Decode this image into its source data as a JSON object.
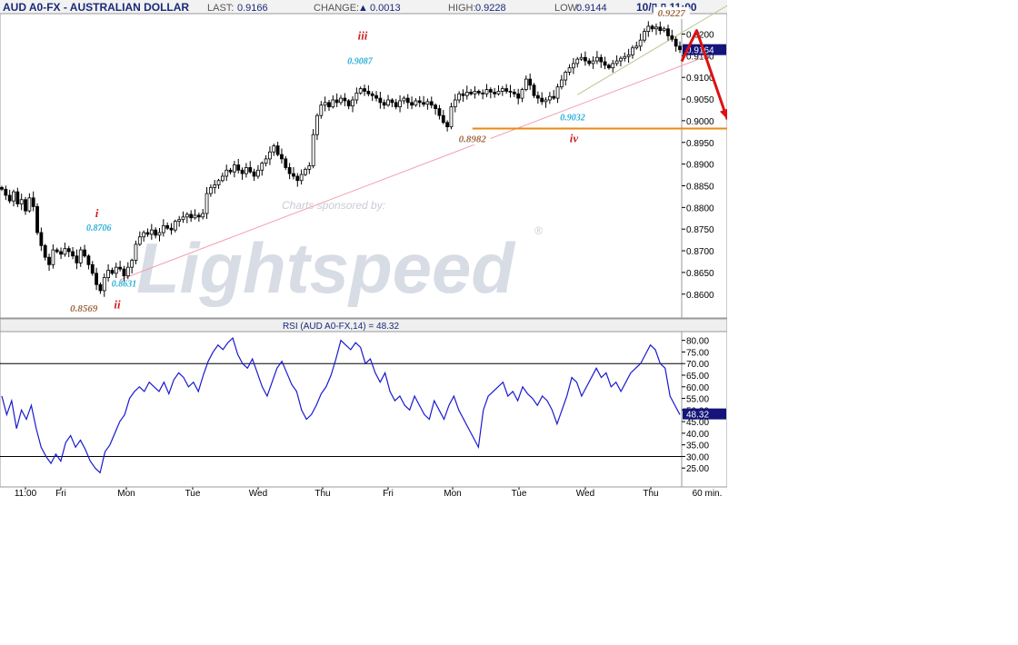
{
  "header": {
    "symbol": "AUD A0-FX - AUSTRALIAN DOLLAR",
    "last_label": "LAST:",
    "last_value": "0.9166",
    "change_label": "CHANGE:",
    "change_arrow": "▲",
    "change_value": "0.0013",
    "high_label": "HIGH:",
    "high_value": "0.9228",
    "low_label": "LOW:",
    "low_value": "0.9144",
    "datetime": "10/▯ ▯ 11:00"
  },
  "colors": {
    "candle": "#000000",
    "rsi_line": "#1a1ad0",
    "trendline_pink": "#f0a0b0",
    "trendline_green": "#b8c890",
    "support_line": "#e88a10",
    "arrow": "#dd1111",
    "wave_label": "#cc2222",
    "value_cyan": "#2ab0d8",
    "value_brown": "#a06a48",
    "last_box": "#14147a"
  },
  "watermark": {
    "sponsor_text": "Charts sponsored by:",
    "logo_text": "Lightspeed",
    "registered": "®"
  },
  "chart_data": [
    {
      "type": "candlestick",
      "title": "AUD A0-FX - AUSTRALIAN DOLLAR",
      "interval": "60 min.",
      "ylim": [
        0.8545,
        0.9245
      ],
      "yticks": [
        "0.9200",
        "0.9150",
        "0.9100",
        "0.9050",
        "0.9000",
        "0.8950",
        "0.8900",
        "0.8850",
        "0.8800",
        "0.8750",
        "0.8700",
        "0.8650",
        "0.8600"
      ],
      "x_labels": [
        "11:00",
        "Fri",
        "Mon",
        "Tue",
        "Wed",
        "Thu",
        "Fri",
        "Mon",
        "Tue",
        "Wed",
        "Thu"
      ],
      "last_price": "0.9164",
      "close_path": [
        0.8842,
        0.8828,
        0.8815,
        0.8836,
        0.8808,
        0.8818,
        0.8792,
        0.8822,
        0.8802,
        0.8742,
        0.8712,
        0.8685,
        0.8668,
        0.8702,
        0.8698,
        0.8692,
        0.8705,
        0.8698,
        0.8688,
        0.8672,
        0.8702,
        0.8688,
        0.8668,
        0.8648,
        0.8622,
        0.8608,
        0.8638,
        0.8655,
        0.8648,
        0.8662,
        0.8658,
        0.8642,
        0.8662,
        0.8678,
        0.8715,
        0.8732,
        0.8742,
        0.8738,
        0.8748,
        0.8736,
        0.8742,
        0.8758,
        0.8752,
        0.8748,
        0.8768,
        0.8772,
        0.8778,
        0.8784,
        0.8776,
        0.8782,
        0.8778,
        0.8786,
        0.8832,
        0.8846,
        0.8852,
        0.8862,
        0.8872,
        0.8886,
        0.8882,
        0.8898,
        0.8886,
        0.8878,
        0.8892,
        0.8882,
        0.8872,
        0.8886,
        0.8902,
        0.8912,
        0.8928,
        0.8942,
        0.8922,
        0.8912,
        0.8892,
        0.8878,
        0.8872,
        0.8862,
        0.8876,
        0.8888,
        0.8896,
        0.8968,
        0.9012,
        0.9036,
        0.9042,
        0.9032,
        0.9048,
        0.9042,
        0.9052,
        0.9046,
        0.9034,
        0.9048,
        0.9064,
        0.9074,
        0.9068,
        0.9062,
        0.9058,
        0.9052,
        0.9042,
        0.9036,
        0.9048,
        0.9042,
        0.9032,
        0.9046,
        0.9052,
        0.9042,
        0.9036,
        0.9046,
        0.9042,
        0.9038,
        0.9044,
        0.9036,
        0.9028,
        0.9012,
        0.8996,
        0.8986,
        0.9032,
        0.9048,
        0.9062,
        0.9058,
        0.9066,
        0.9062,
        0.9068,
        0.9064,
        0.9062,
        0.9072,
        0.9066,
        0.9062,
        0.9068,
        0.9074,
        0.9068,
        0.9066,
        0.9062,
        0.9052,
        0.9072,
        0.9096,
        0.9082,
        0.9058,
        0.9052,
        0.9044,
        0.9048,
        0.9056,
        0.9052,
        0.9078,
        0.9094,
        0.9112,
        0.9122,
        0.9132,
        0.9142,
        0.9146,
        0.9138,
        0.9132,
        0.9138,
        0.9146,
        0.9136,
        0.9128,
        0.9122,
        0.9132,
        0.9138,
        0.9144,
        0.9148,
        0.9152,
        0.9168,
        0.9172,
        0.9186,
        0.9206,
        0.9218,
        0.9212,
        0.9216,
        0.9208,
        0.9212,
        0.9196,
        0.9188,
        0.9172,
        0.9164
      ],
      "annotations": [
        {
          "label": "i",
          "kind": "wave",
          "x_frac": 0.142,
          "y": 0.8778
        },
        {
          "label": "ii",
          "kind": "wave",
          "x_frac": 0.172,
          "y": 0.8567
        },
        {
          "label": "iii",
          "kind": "wave",
          "x_frac": 0.532,
          "y": 0.9187
        },
        {
          "label": "iv",
          "kind": "wave",
          "x_frac": 0.842,
          "y": 0.8951
        },
        {
          "label": "0.8706",
          "kind": "value-cyan",
          "x_frac": 0.145,
          "y": 0.8746
        },
        {
          "label": "0.8631",
          "kind": "value-cyan",
          "x_frac": 0.182,
          "y": 0.8617
        },
        {
          "label": "0.9087",
          "kind": "value-cyan",
          "x_frac": 0.528,
          "y": 0.9131
        },
        {
          "label": "0.9032",
          "kind": "value-cyan",
          "x_frac": 0.84,
          "y": 0.9001
        },
        {
          "label": "0.8569",
          "kind": "value-brown",
          "x_frac": 0.123,
          "y": 0.856
        },
        {
          "label": "0.8982",
          "kind": "value-brown",
          "x_frac": 0.693,
          "y": 0.8951
        },
        {
          "label": "0.9227",
          "kind": "value-brown",
          "x_frac": 0.985,
          "y": 0.9241
        }
      ],
      "trendlines": [
        {
          "name": "pink",
          "from": [
            0.176,
            0.8633
          ],
          "to": [
            1.195,
            0.9244
          ]
        },
        {
          "name": "green",
          "from": [
            0.847,
            0.906
          ],
          "to": [
            1.095,
            0.9292
          ]
        }
      ],
      "support_level": 0.8982,
      "projection_arrow": [
        [
          1.0,
          0.9137
        ],
        [
          1.022,
          0.9208
        ],
        [
          1.067,
          0.9003
        ]
      ]
    },
    {
      "type": "line",
      "title": "RSI (AUD A0-FX,14) = 48.32",
      "ylim": [
        20,
        83
      ],
      "yticks": [
        "80.00",
        "75.00",
        "70.00",
        "65.00",
        "60.00",
        "55.00",
        "50.00",
        "45.00",
        "40.00",
        "35.00",
        "30.00",
        "25.00"
      ],
      "levels": [
        70,
        30
      ],
      "current": "48.32",
      "series": [
        {
          "values": [
            56,
            48,
            54,
            42,
            50,
            46,
            52,
            42,
            34,
            30,
            27,
            31,
            28,
            36,
            39,
            34,
            37,
            33,
            28,
            25,
            23,
            32,
            35,
            40,
            45,
            48,
            55,
            58,
            60,
            58,
            62,
            60,
            58,
            62,
            57,
            63,
            66,
            64,
            60,
            62,
            58,
            65,
            71,
            75,
            78,
            76,
            79,
            81,
            74,
            70,
            68,
            72,
            66,
            60,
            56,
            62,
            68,
            71,
            66,
            61,
            58,
            50,
            46,
            48,
            52,
            57,
            60,
            65,
            72,
            80,
            78,
            76,
            79,
            77,
            70,
            72,
            66,
            62,
            66,
            58,
            54,
            56,
            52,
            50,
            56,
            52,
            48,
            46,
            54,
            50,
            46,
            52,
            56,
            50,
            46,
            42,
            38,
            34,
            50,
            56,
            58,
            60,
            62,
            56,
            58,
            54,
            60,
            57,
            55,
            52,
            56,
            54,
            50,
            44,
            50,
            56,
            64,
            62,
            56,
            60,
            64,
            68,
            64,
            66,
            60,
            62,
            58,
            62,
            66,
            68,
            70,
            74,
            78,
            76,
            70,
            68,
            56,
            52,
            48
          ]
        }
      ]
    }
  ]
}
